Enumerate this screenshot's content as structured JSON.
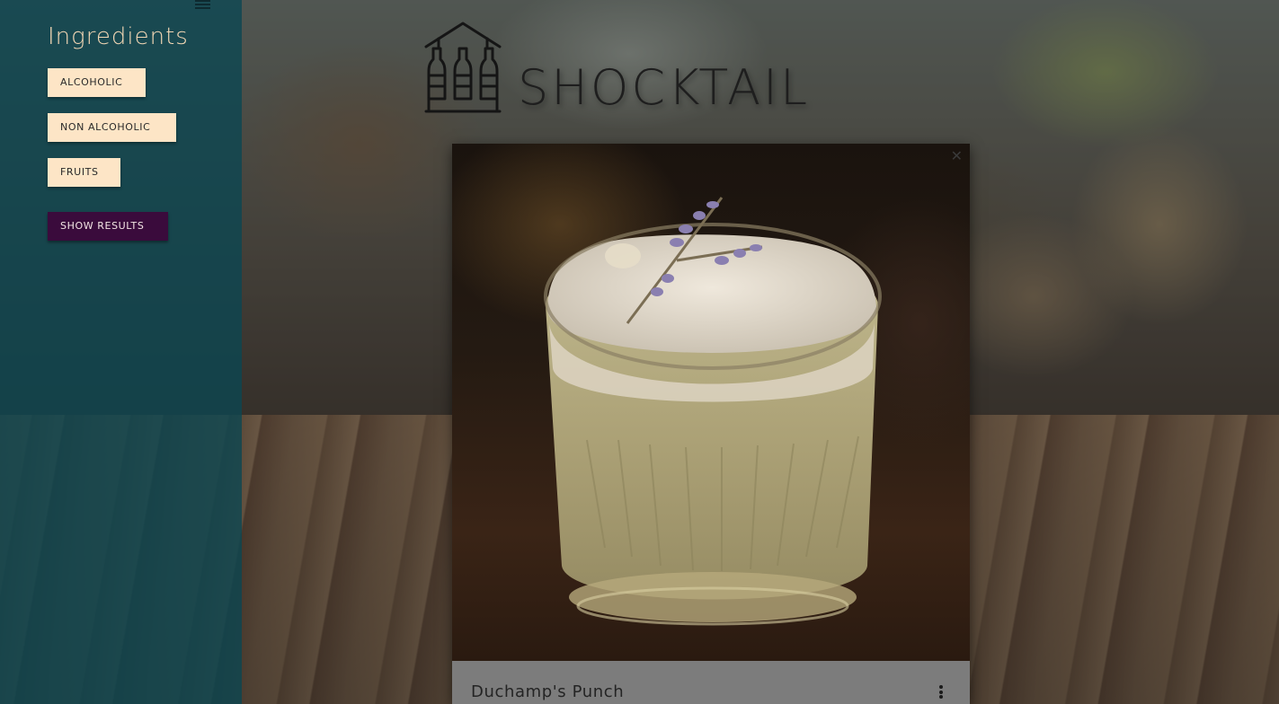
{
  "sidebar": {
    "menu_icon": "hamburger-menu-icon",
    "title": "Ingredients",
    "filters": [
      {
        "label": "ALCOHOLIC"
      },
      {
        "label": "NON ALCOHOLIC"
      },
      {
        "label": "FRUITS"
      }
    ],
    "show_results_label": "SHOW RESULTS"
  },
  "header": {
    "logo_icon": "house-bottles-icon",
    "brand": "SHOCKTAIL"
  },
  "card": {
    "image": "cocktail-photo",
    "close_icon": "close-icon",
    "title": "Duchamp's Punch",
    "more_icon": "more-vert-icon"
  },
  "colors": {
    "sidebar_bg": "#0a4652",
    "chip_bg": "#fde5c6",
    "primary_button_bg": "#3a0b3c",
    "sidebar_title": "#f1d6b4"
  }
}
